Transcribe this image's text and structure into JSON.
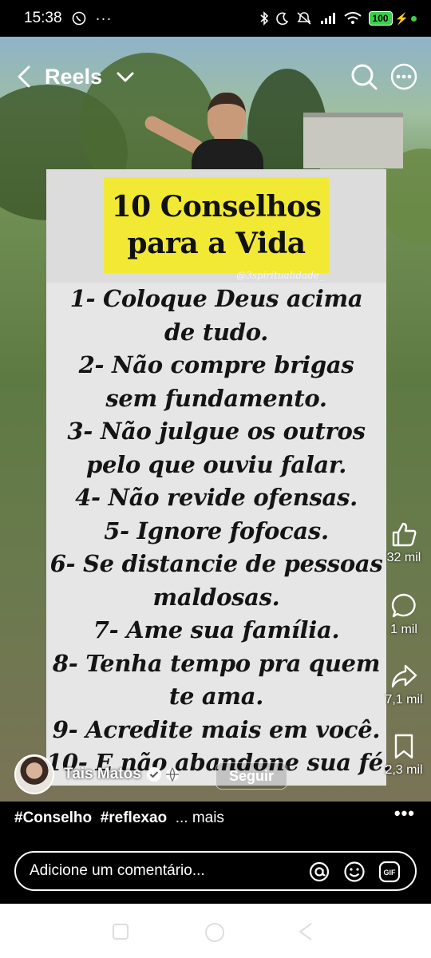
{
  "status_bar": {
    "time": "15:38",
    "battery": "100"
  },
  "header": {
    "title": "Reels"
  },
  "post": {
    "title_lines": [
      "10 Conselhos",
      "para a Vida"
    ],
    "watermark": "@3spiritualidade_",
    "advice_lines": [
      "1- Coloque Deus acima",
      "de tudo.",
      "2- Não compre brigas",
      "sem fundamento.",
      "3- Não julgue os outros",
      "pelo que ouviu falar.",
      "4- Não revide ofensas.",
      "5- Ignore fofocas.",
      "6- Se distancie de pessoas",
      "maldosas.",
      "7- Ame sua família.",
      "8- Tenha tempo pra quem",
      "te ama.",
      "9- Acredite mais em você.",
      "10- E não abandone sua fé."
    ]
  },
  "actions": {
    "likes": "32 mil",
    "comments": "1 mil",
    "shares": "7,1 mil",
    "saves": "2,3 mil"
  },
  "author": {
    "name": "Tais Matos",
    "follow_label": "Seguir"
  },
  "caption": {
    "tag1": "#Conselho",
    "tag2": "#reflexao",
    "more": "... mais"
  },
  "comment_box": {
    "placeholder": "Adicione um comentário..."
  },
  "colors": {
    "title_highlight": "#f2e935",
    "battery": "#3ccf4e"
  }
}
